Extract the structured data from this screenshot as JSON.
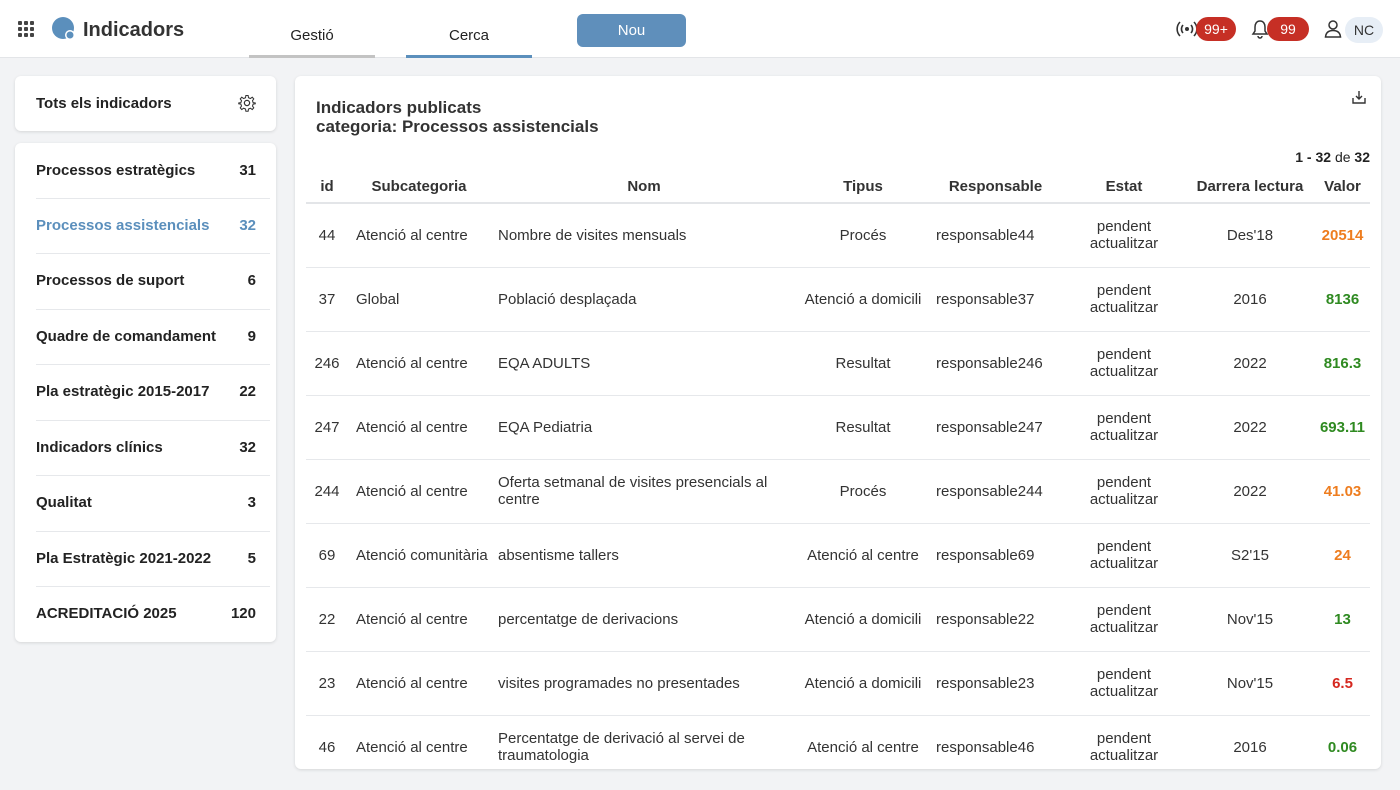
{
  "header": {
    "app_title": "Indicadors",
    "tabs": [
      {
        "label": "Gestió"
      },
      {
        "label": "Cerca"
      }
    ],
    "new_button": "Nou",
    "signal_badge": "99+",
    "notifications_badge": "99",
    "user_initials": "NC",
    "colors": {
      "brand": "#5b8fbc",
      "badge": "#c62f25"
    }
  },
  "sidebar": {
    "all_label": "Tots els indicadors",
    "categories": [
      {
        "label": "Processos estratègics",
        "count": "31"
      },
      {
        "label": "Processos assistencials",
        "count": "32"
      },
      {
        "label": "Processos de suport",
        "count": "6"
      },
      {
        "label": "Quadre de comandament",
        "count": "9"
      },
      {
        "label": "Pla estratègic 2015-2017",
        "count": "22"
      },
      {
        "label": "Indicadors clínics",
        "count": "32"
      },
      {
        "label": "Qualitat",
        "count": "3"
      },
      {
        "label": "Pla Estratègic 2021-2022",
        "count": "5"
      },
      {
        "label": "ACREDITACIÓ 2025",
        "count": "120"
      }
    ]
  },
  "main": {
    "title_line1": "Indicadors publicats",
    "title_line2": "categoria: Processos assistencials",
    "pager": {
      "range": "1 - 32",
      "of": "de",
      "total": "32"
    },
    "columns": {
      "id": "id",
      "sub": "Subcategoria",
      "nom": "Nom",
      "tip": "Tipus",
      "resp": "Responsable",
      "est": "Estat",
      "dl": "Darrera lectura",
      "val": "Valor"
    },
    "rows": [
      {
        "id": "44",
        "sub": "Atenció al centre",
        "nom": "Nombre de visites mensuals",
        "tip": "Procés",
        "resp": "responsable44",
        "est": "pendent actualitzar",
        "dl": "Des'18",
        "val": "20514",
        "color": "orange"
      },
      {
        "id": "37",
        "sub": "Global",
        "nom": "Població desplaçada",
        "tip": "Atenció a domicili",
        "resp": "responsable37",
        "est": "pendent actualitzar",
        "dl": "2016",
        "val": "8136",
        "color": "green"
      },
      {
        "id": "246",
        "sub": "Atenció al centre",
        "nom": "EQA ADULTS",
        "tip": "Resultat",
        "resp": "responsable246",
        "est": "pendent actualitzar",
        "dl": "2022",
        "val": "816.3",
        "color": "green"
      },
      {
        "id": "247",
        "sub": "Atenció al centre",
        "nom": "EQA Pediatria",
        "tip": "Resultat",
        "resp": "responsable247",
        "est": "pendent actualitzar",
        "dl": "2022",
        "val": "693.11",
        "color": "green"
      },
      {
        "id": "244",
        "sub": "Atenció al centre",
        "nom": "Oferta setmanal de visites presencials al centre",
        "tip": "Procés",
        "resp": "responsable244",
        "est": "pendent actualitzar",
        "dl": "2022",
        "val": "41.03",
        "color": "orange"
      },
      {
        "id": "69",
        "sub": "Atenció comunitària",
        "nom": "absentisme tallers",
        "tip": "Atenció al centre",
        "resp": "responsable69",
        "est": "pendent actualitzar",
        "dl": "S2'15",
        "val": "24",
        "color": "orange"
      },
      {
        "id": "22",
        "sub": "Atenció al centre",
        "nom": "percentatge de derivacions",
        "tip": "Atenció a domicili",
        "resp": "responsable22",
        "est": "pendent actualitzar",
        "dl": "Nov'15",
        "val": "13",
        "color": "green"
      },
      {
        "id": "23",
        "sub": "Atenció al centre",
        "nom": "visites programades no presentades",
        "tip": "Atenció a domicili",
        "resp": "responsable23",
        "est": "pendent actualitzar",
        "dl": "Nov'15",
        "val": "6.5",
        "color": "red"
      },
      {
        "id": "46",
        "sub": "Atenció al centre",
        "nom": "Percentatge de derivació al servei de traumatologia",
        "tip": "Atenció al centre",
        "resp": "responsable46",
        "est": "pendent actualitzar",
        "dl": "2016",
        "val": "0.06",
        "color": "green"
      }
    ]
  }
}
